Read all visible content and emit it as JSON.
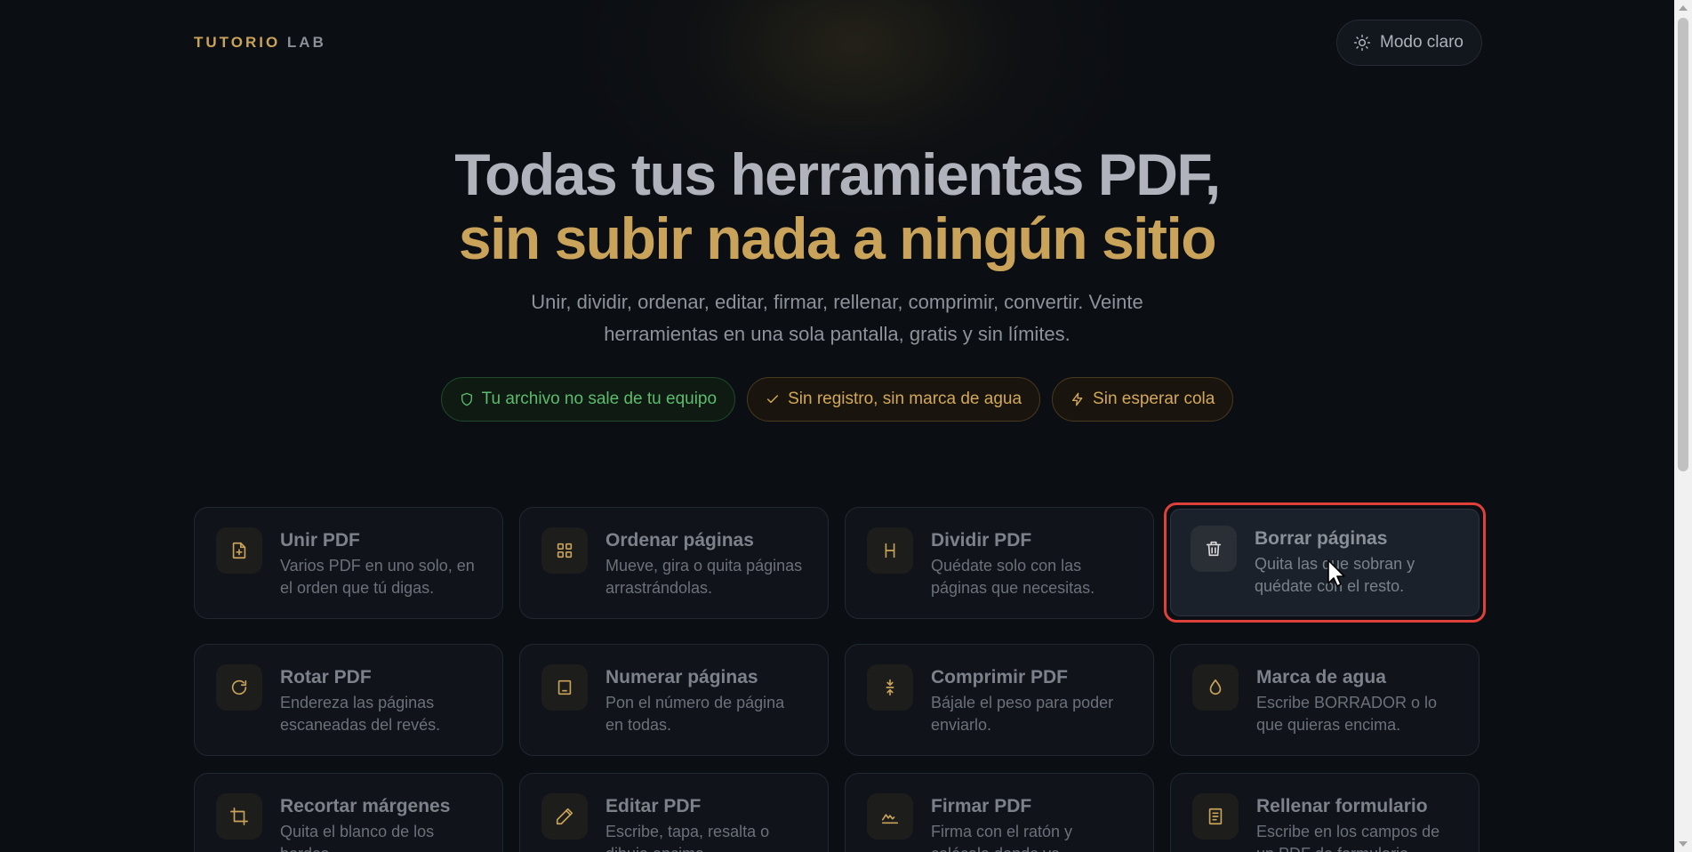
{
  "brand": {
    "name_part1": "TUTORIO",
    "name_part2": "LAB"
  },
  "theme_toggle": {
    "label": "Modo claro",
    "icon": "sun-icon"
  },
  "hero": {
    "title_line1": "Todas tus herramientas PDF,",
    "title_line2": "sin subir nada a ningún sitio",
    "subtitle": "Unir, dividir, ordenar, editar, firmar, rellenar, comprimir, convertir. Veinte herramientas en una sola pantalla, gratis y sin límites."
  },
  "badges": [
    {
      "label": "Tu archivo no sale de tu equipo",
      "icon": "shield-icon",
      "color": "#5dbb6d"
    },
    {
      "label": "Sin registro, sin marca de agua",
      "icon": "check-icon",
      "color": "#d2a858"
    },
    {
      "label": "Sin esperar cola",
      "icon": "bolt-icon",
      "color": "#d2a858"
    }
  ],
  "tools": [
    {
      "title": "Unir PDF",
      "desc": "Varios PDF en uno solo, en el orden que tú digas.",
      "icon": "file-plus-icon"
    },
    {
      "title": "Ordenar páginas",
      "desc": "Mueve, gira o quita páginas arrastrándolas.",
      "icon": "grid-icon"
    },
    {
      "title": "Dividir PDF",
      "desc": "Quédate solo con las páginas que necesitas.",
      "icon": "split-icon"
    },
    {
      "title": "Borrar páginas",
      "desc": "Quita las que sobran y quédate con el resto.",
      "icon": "trash-icon"
    },
    {
      "title": "Rotar PDF",
      "desc": "Endereza las páginas escaneadas del revés.",
      "icon": "rotate-icon"
    },
    {
      "title": "Numerar páginas",
      "desc": "Pon el número de página en todas.",
      "icon": "page-number-icon"
    },
    {
      "title": "Comprimir PDF",
      "desc": "Bájale el peso para poder enviarlo.",
      "icon": "compress-icon"
    },
    {
      "title": "Marca de agua",
      "desc": "Escribe BORRADOR o lo que quieras encima.",
      "icon": "droplet-icon"
    },
    {
      "title": "Recortar márgenes",
      "desc": "Quita el blanco de los bordes.",
      "icon": "crop-icon"
    },
    {
      "title": "Editar PDF",
      "desc": "Escribe, tapa, resalta o dibuja encima.",
      "icon": "pencil-icon"
    },
    {
      "title": "Firmar PDF",
      "desc": "Firma con el ratón y colócala donde va.",
      "icon": "signature-icon"
    },
    {
      "title": "Rellenar formulario",
      "desc": "Escribe en los campos de un PDF de formulario.",
      "icon": "form-icon"
    }
  ],
  "colors": {
    "accent": "#c9a35a",
    "background": "#0b0e13",
    "highlight_border": "#e0403a"
  }
}
